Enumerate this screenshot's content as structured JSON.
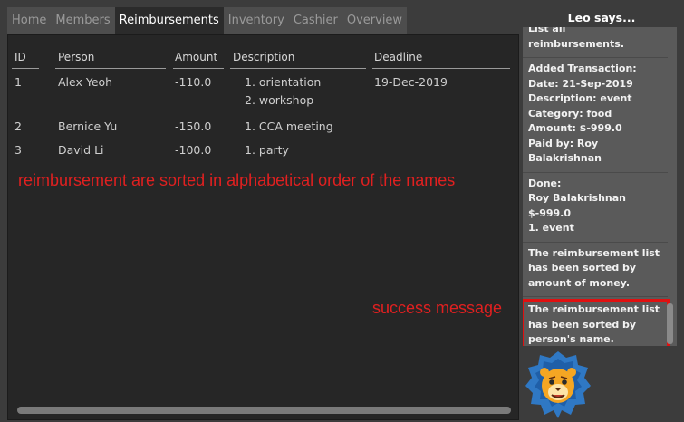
{
  "tabs": [
    {
      "label": "Home",
      "active": false
    },
    {
      "label": "Members",
      "active": false
    },
    {
      "label": "Reimbursements",
      "active": true
    },
    {
      "label": "Inventory",
      "active": false
    },
    {
      "label": "Cashier",
      "active": false
    },
    {
      "label": "Overview",
      "active": false
    }
  ],
  "table": {
    "headers": {
      "id": "ID",
      "person": "Person",
      "amount": "Amount",
      "description": "Description",
      "deadline": "Deadline"
    },
    "rows": [
      {
        "id": "1",
        "person": "Alex Yeoh",
        "amount": "-110.0",
        "desc1": "1. orientation",
        "desc2": "2. workshop",
        "deadline": "19-Dec-2019"
      },
      {
        "id": "2",
        "person": "Bernice Yu",
        "amount": "-150.0",
        "desc1": "1. CCA meeting",
        "desc2": "",
        "deadline": ""
      },
      {
        "id": "3",
        "person": "David Li",
        "amount": "-100.0",
        "desc1": "1. party",
        "desc2": "",
        "deadline": ""
      }
    ]
  },
  "annotations": {
    "sort_note": "reimbursement are sorted in alphabetical order of the names",
    "success_note": "success message"
  },
  "assistant": {
    "title": "Leo says...",
    "messages": [
      "List all reimbursements.",
      "Added Transaction:\nDate: 21-Sep-2019\nDescription: event\nCategory: food\nAmount: $-999.0\nPaid by: Roy\nBalakrishnan",
      "Done:\nRoy Balakrishnan\n$-999.0\n1. event",
      "The reimbursement list\nhas been sorted by\namount of money.",
      "The reimbursement list\nhas been sorted by\nperson's name."
    ],
    "highlight_color": "#e01010",
    "avatar_icon": "lion-icon"
  },
  "colors": {
    "panel": "#262626",
    "background": "#3c3c3c",
    "annotation": "#e02020"
  }
}
